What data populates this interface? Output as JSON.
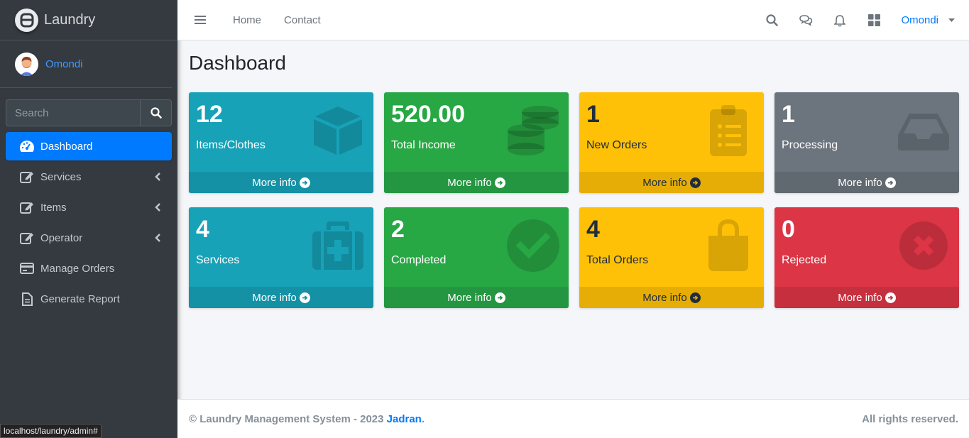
{
  "brand": {
    "name": "Laundry"
  },
  "user": {
    "name": "Omondi"
  },
  "sidebar": {
    "search_placeholder": "Search",
    "items": [
      {
        "label": "Dashboard",
        "icon": "tachometer-icon",
        "active": true,
        "has_caret": false
      },
      {
        "label": "Services",
        "icon": "edit-icon",
        "active": false,
        "has_caret": true
      },
      {
        "label": "Items",
        "icon": "edit-icon",
        "active": false,
        "has_caret": true
      },
      {
        "label": "Operator",
        "icon": "edit-icon",
        "active": false,
        "has_caret": true
      },
      {
        "label": "Manage Orders",
        "icon": "credit-card-icon",
        "active": false,
        "has_caret": false
      },
      {
        "label": "Generate Report",
        "icon": "file-icon",
        "active": false,
        "has_caret": false
      }
    ]
  },
  "topbar": {
    "links": [
      "Home",
      "Contact"
    ],
    "user_name": "Omondi"
  },
  "main": {
    "title": "Dashboard",
    "boxes": [
      {
        "value": "12",
        "label": "Items/Clothes",
        "footer": "More info",
        "color": "info",
        "icon": "cube-icon"
      },
      {
        "value": "520.00",
        "label": "Total Income",
        "footer": "More info",
        "color": "success",
        "icon": "coins-icon"
      },
      {
        "value": "1",
        "label": "New Orders",
        "footer": "More info",
        "color": "warning",
        "icon": "clipboard-list-icon"
      },
      {
        "value": "1",
        "label": "Processing",
        "footer": "More info",
        "color": "secondary",
        "icon": "inbox-icon"
      },
      {
        "value": "4",
        "label": "Services",
        "footer": "More info",
        "color": "info",
        "icon": "medkit-icon"
      },
      {
        "value": "2",
        "label": "Completed",
        "footer": "More info",
        "color": "success",
        "icon": "check-circle-icon"
      },
      {
        "value": "4",
        "label": "Total Orders",
        "footer": "More info",
        "color": "warning",
        "icon": "shopping-bag-icon"
      },
      {
        "value": "0",
        "label": "Rejected",
        "footer": "More info",
        "color": "danger",
        "icon": "times-circle-icon"
      }
    ]
  },
  "footer": {
    "text": "© Laundry Management System - 2023",
    "author": "Jadran",
    "rights": "All rights reserved."
  },
  "status_bar": {
    "url": "localhost/laundry/admin#"
  },
  "colors": {
    "info": "#17a2b8",
    "success": "#28a745",
    "warning": "#ffc107",
    "secondary": "#6c757d",
    "danger": "#dc3545",
    "primary": "#007bff",
    "sidebar": "#343a40"
  }
}
